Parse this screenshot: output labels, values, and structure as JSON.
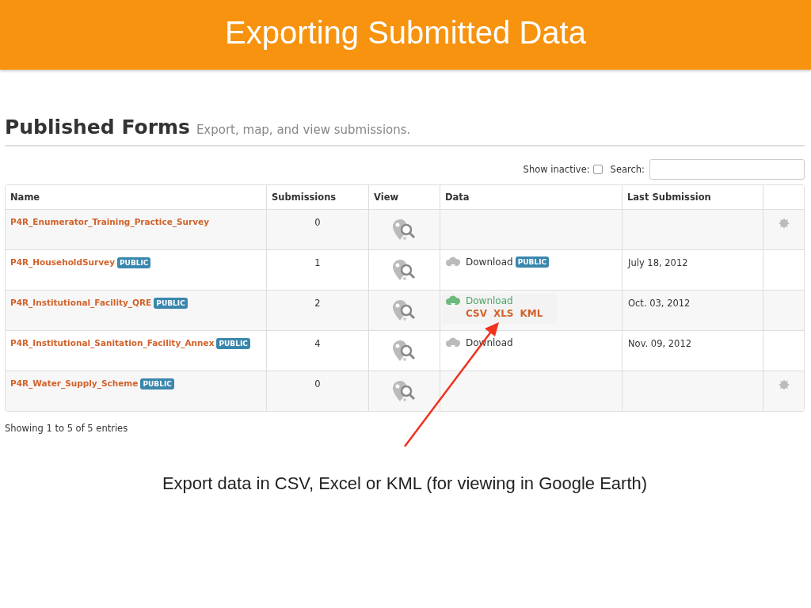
{
  "slide_title": "Exporting Submitted Data",
  "page": {
    "heading": "Published Forms",
    "subheading": "Export, map, and view submissions."
  },
  "filters": {
    "show_inactive_label": "Show inactive:",
    "show_inactive_checked": false,
    "search_label": "Search:"
  },
  "table": {
    "columns": [
      "Name",
      "Submissions",
      "View",
      "Data",
      "Last Submission"
    ],
    "rows": [
      {
        "name": "P4R_Enumerator_Training_Practice_Survey",
        "submissions": "0",
        "data": {
          "kind": "none"
        },
        "last_submission": "",
        "settings": true
      },
      {
        "name": "P4R_HouseholdSurvey",
        "badge": "PUBLIC",
        "submissions": "1",
        "data": {
          "kind": "download",
          "label": "Download",
          "badge": "PUBLIC"
        },
        "last_submission": "July 18, 2012",
        "settings": false
      },
      {
        "name": "P4R_Institutional_Facility_QRE",
        "badge": "PUBLIC",
        "submissions": "2",
        "data": {
          "kind": "export",
          "label": "Download",
          "formats": [
            "CSV",
            "XLS",
            "KML"
          ]
        },
        "last_submission": "Oct. 03, 2012",
        "settings": false
      },
      {
        "name": "P4R_Institutional_Sanitation_Facility_Annex",
        "badge": "PUBLIC",
        "submissions": "4",
        "data": {
          "kind": "download",
          "label": "Download"
        },
        "last_submission": "Nov. 09, 2012",
        "settings": false
      },
      {
        "name": "P4R_Water_Supply_Scheme",
        "badge": "PUBLIC",
        "submissions": "0",
        "data": {
          "kind": "none"
        },
        "last_submission": "",
        "settings": true
      }
    ]
  },
  "footer": "Showing 1 to 5 of 5 entries",
  "caption": "Export data in CSV, Excel or KML (for viewing in Google Earth)"
}
